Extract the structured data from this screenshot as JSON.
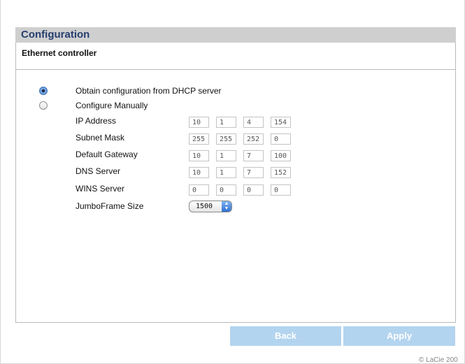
{
  "header": {
    "title": "Configuration"
  },
  "section": {
    "title": "Ethernet controller"
  },
  "options": {
    "dhcp_label": "Obtain configuration from DHCP server",
    "manual_label": "Configure Manually",
    "selected": "dhcp"
  },
  "fields": [
    {
      "label": "IP Address",
      "values": [
        "10",
        "1",
        "4",
        "154"
      ]
    },
    {
      "label": "Subnet Mask",
      "values": [
        "255",
        "255",
        "252",
        "0"
      ]
    },
    {
      "label": "Default Gateway",
      "values": [
        "10",
        "1",
        "7",
        "100"
      ]
    },
    {
      "label": "DNS Server",
      "values": [
        "10",
        "1",
        "7",
        "152"
      ]
    },
    {
      "label": "WINS Server",
      "values": [
        "0",
        "0",
        "0",
        "0"
      ]
    }
  ],
  "jumbo": {
    "label": "JumboFrame Size",
    "value": "1500"
  },
  "buttons": {
    "back": "Back",
    "apply": "Apply"
  },
  "footer": {
    "copyright": "© LaCie 200"
  },
  "colors": {
    "header_bg": "#cfcfcf",
    "title_text": "#253e6e",
    "button_bg": "#b3d4ef"
  }
}
